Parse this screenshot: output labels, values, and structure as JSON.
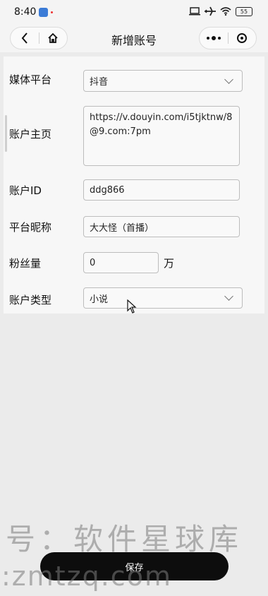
{
  "status_bar": {
    "time": "8:40",
    "battery": "55"
  },
  "nav": {
    "title": "新增账号"
  },
  "form": {
    "platform": {
      "label": "媒体平台",
      "value": "抖音"
    },
    "homepage": {
      "label": "账户主页",
      "value": "https://v.douyin.com/i5tjktnw/8@9.com:7pm"
    },
    "account_id": {
      "label": "账户ID",
      "value": "ddg866"
    },
    "nickname": {
      "label": "平台昵称",
      "value": "大大怪（首播）"
    },
    "followers": {
      "label": "粉丝量",
      "value": "0",
      "unit": "万"
    },
    "account_type": {
      "label": "账户类型",
      "value": "小说"
    }
  },
  "watermark": {
    "line1": "号：软件星球库",
    "line2": ":zmtzq.com"
  },
  "actions": {
    "save_label": "保存"
  },
  "colors": {
    "primary_button": "#0d0d0d",
    "background": "#ebebeb"
  }
}
